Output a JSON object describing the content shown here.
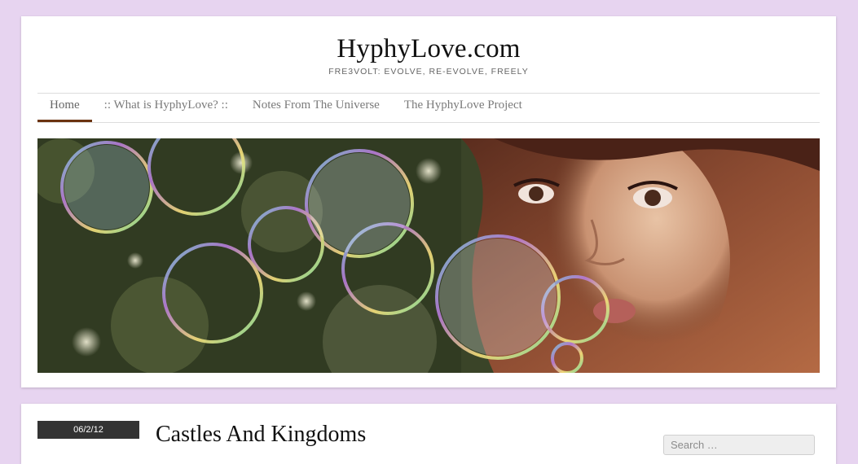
{
  "site": {
    "title": "HyphyLove.com",
    "tagline": "FRE3VOLT: EVOLVE, RE-EVOLVE, FREELY"
  },
  "nav": {
    "items": [
      {
        "label": "Home",
        "active": true
      },
      {
        "label": ":: What is HyphyLove? ::",
        "active": false
      },
      {
        "label": "Notes From The Universe",
        "active": false
      },
      {
        "label": "The HyphyLove Project",
        "active": false
      }
    ],
    "active_color": "#6b3310"
  },
  "post": {
    "date": "06/2/12",
    "title": "Castles And Kingdoms"
  },
  "search": {
    "placeholder": "Search …"
  },
  "colors": {
    "page_background": "#e7d4f0",
    "date_badge": "#333333"
  }
}
